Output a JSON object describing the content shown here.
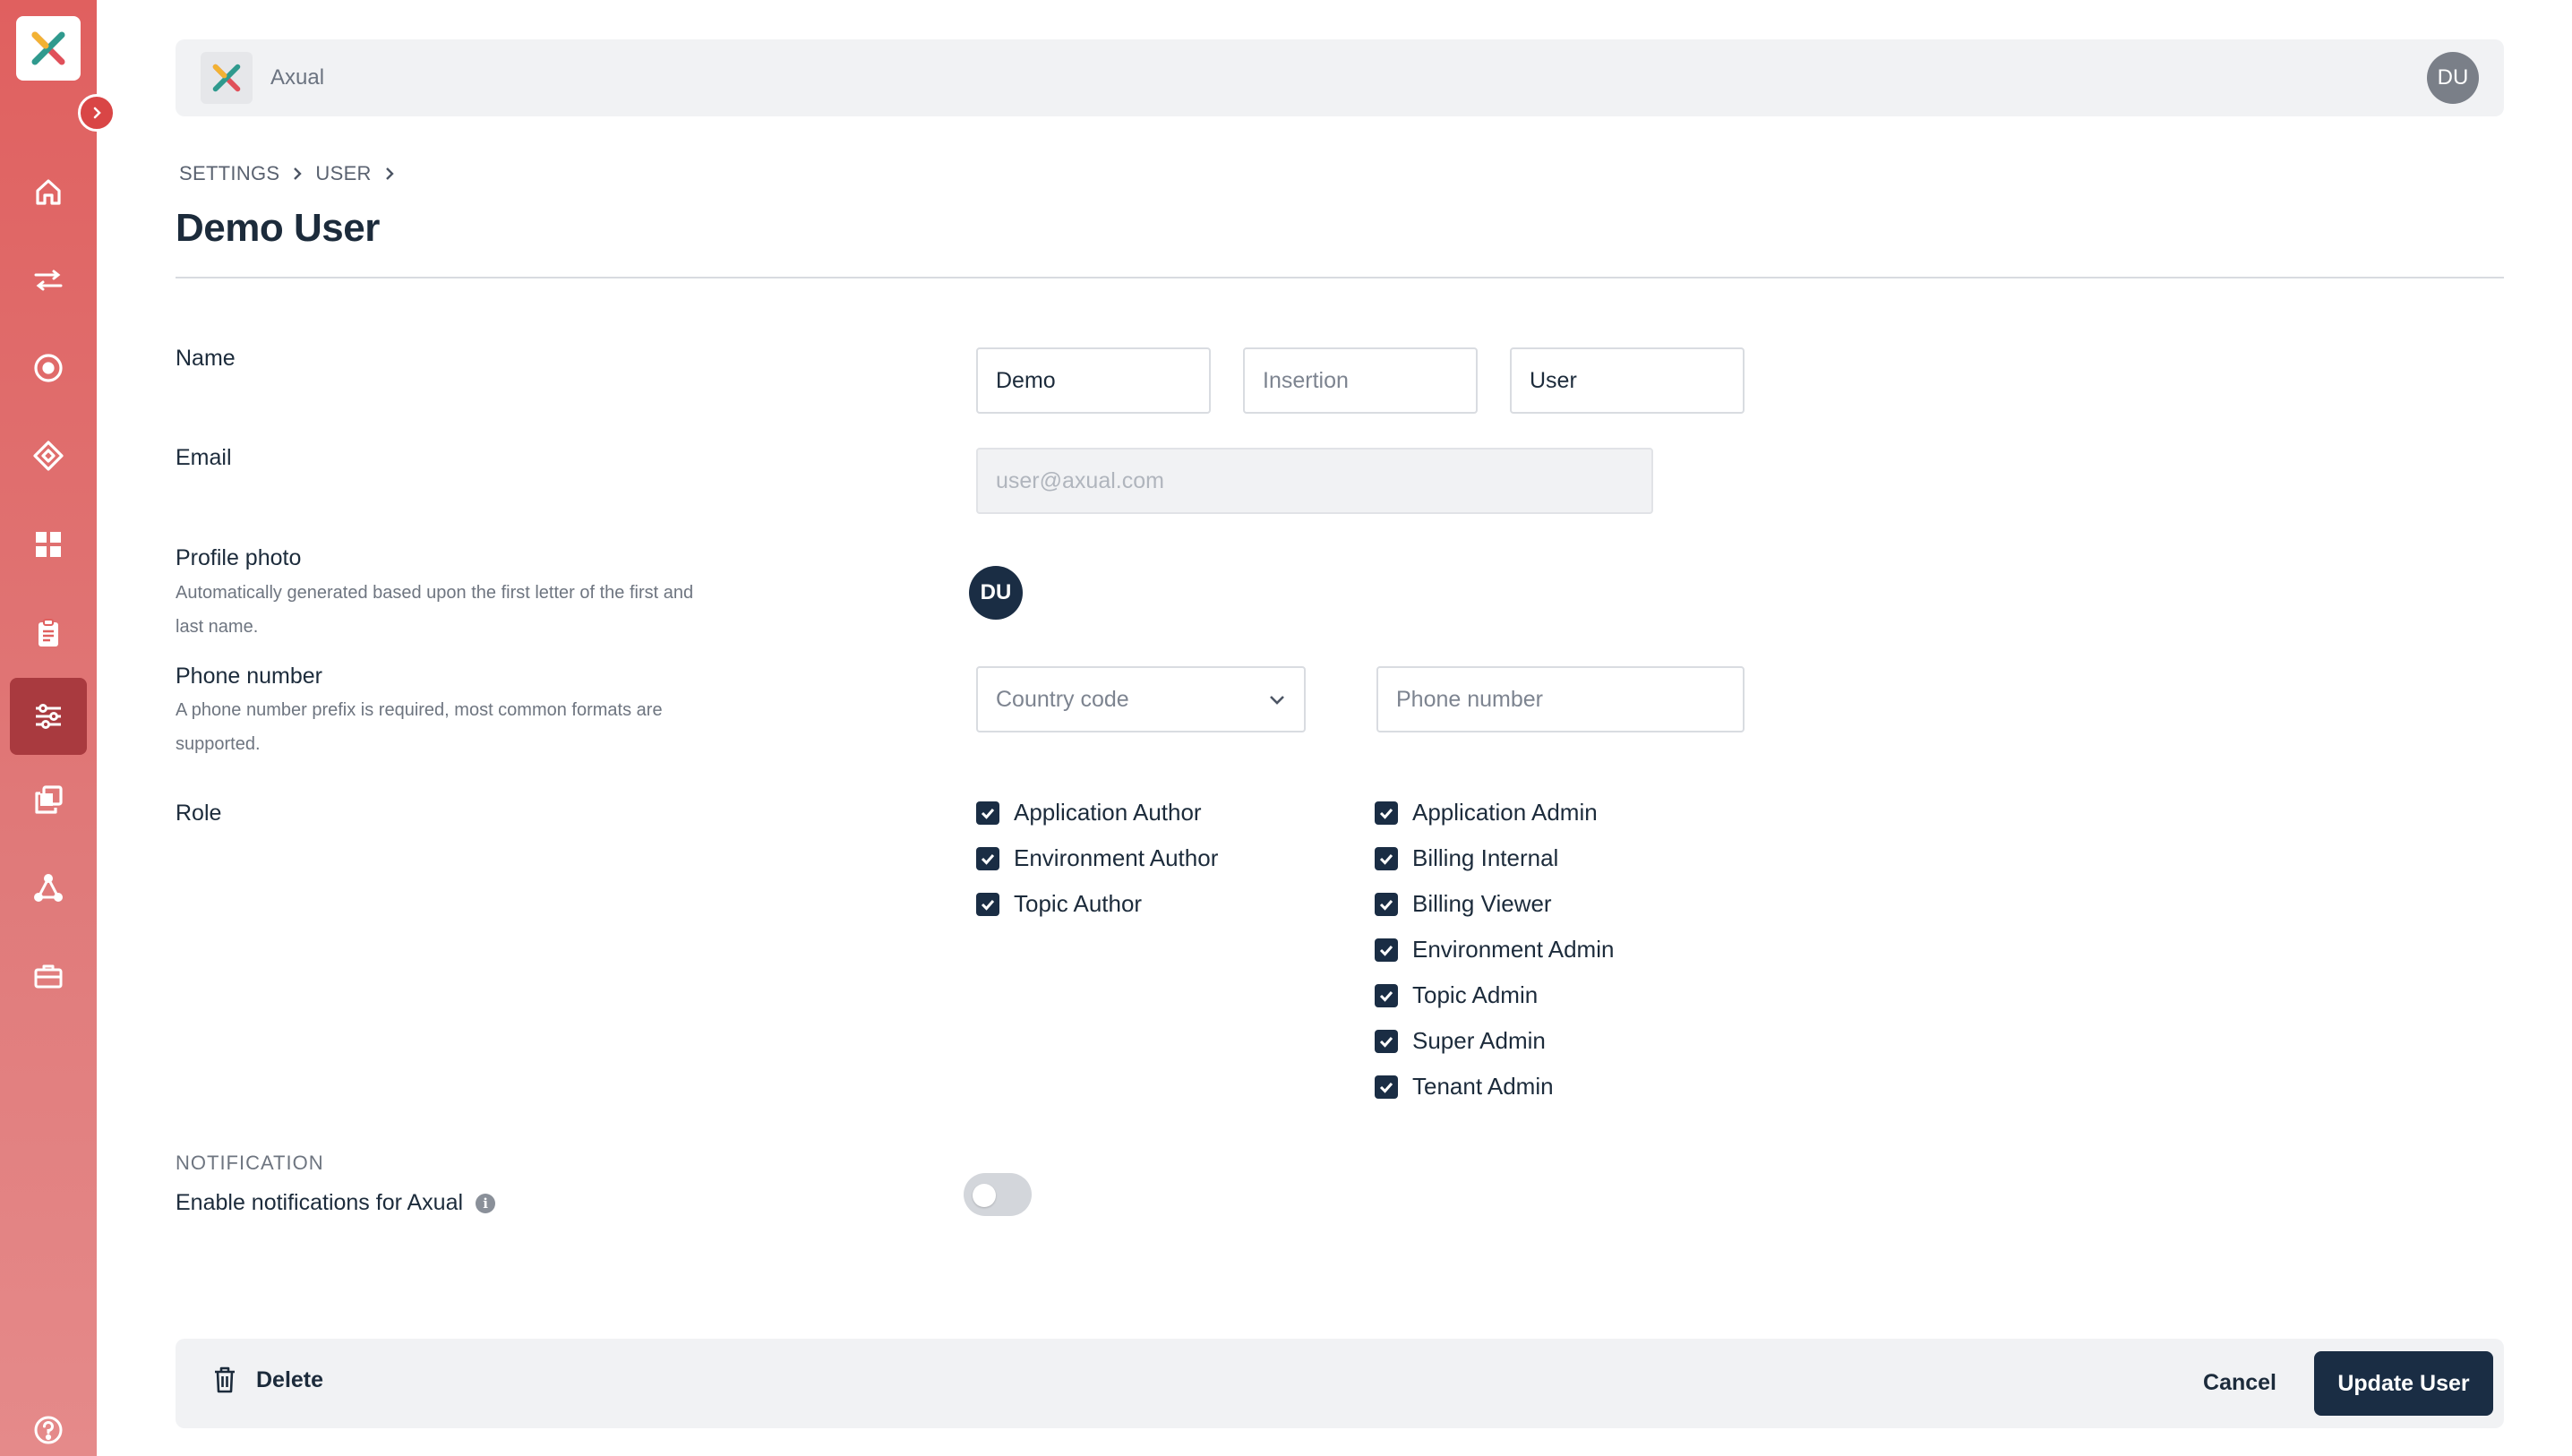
{
  "app": {
    "brand_name": "Axual",
    "user_initials": "DU"
  },
  "sidebar": {
    "items": [
      {
        "icon": "home-icon"
      },
      {
        "icon": "streams-icon"
      },
      {
        "icon": "target-icon"
      },
      {
        "icon": "diamond-icon"
      },
      {
        "icon": "dashboard-grid-icon"
      },
      {
        "icon": "clipboard-icon"
      },
      {
        "icon": "settings-sliders-icon",
        "active": true
      },
      {
        "icon": "copy-icon"
      },
      {
        "icon": "network-icon"
      },
      {
        "icon": "toolbox-icon"
      }
    ],
    "help_icon": "help-circle-icon"
  },
  "breadcrumb": {
    "items": [
      "SETTINGS",
      "USER"
    ]
  },
  "page": {
    "title": "Demo User"
  },
  "form": {
    "name": {
      "label": "Name",
      "first": "Demo",
      "insertion_placeholder": "Insertion",
      "last": "User"
    },
    "email": {
      "label": "Email",
      "value": "user@axual.com"
    },
    "profile_photo": {
      "label": "Profile photo",
      "help_line1": "Automatically generated based upon the first letter of the first and",
      "help_line2": "last name.",
      "initials": "DU"
    },
    "phone": {
      "label": "Phone number",
      "help_line1": "A phone number prefix is required, most common formats are",
      "help_line2": "supported.",
      "country_placeholder": "Country code",
      "number_placeholder": "Phone number"
    },
    "role": {
      "label": "Role",
      "column1": [
        "Application Author",
        "Environment Author",
        "Topic Author"
      ],
      "column2": [
        "Application Admin",
        "Billing Internal",
        "Billing Viewer",
        "Environment Admin",
        "Topic Admin",
        "Super Admin",
        "Tenant Admin"
      ]
    }
  },
  "notification": {
    "heading": "NOTIFICATION",
    "label": "Enable notifications for Axual",
    "info_glyph": "i",
    "enabled": false
  },
  "footer": {
    "delete_label": "Delete",
    "cancel_label": "Cancel",
    "update_label": "Update User"
  },
  "colors": {
    "sidebar": "#e0605f",
    "sidebar_active": "#a93a3f",
    "primary": "#1a2d44",
    "surface": "#f1f2f4"
  }
}
